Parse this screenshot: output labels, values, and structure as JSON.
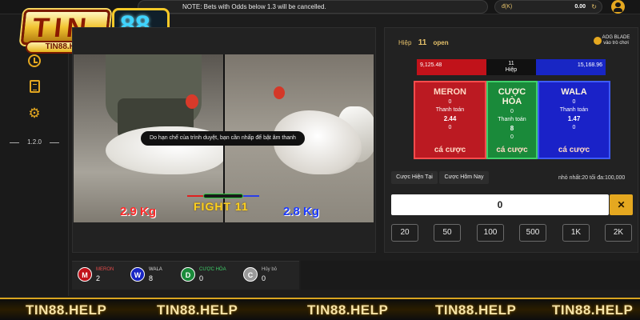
{
  "notice": "NOTE: Bets with Odds below 1.3 will be cancelled.",
  "wallet": {
    "currency": "đ(K)",
    "balance": "0.00",
    "refresh_glyph": "↻"
  },
  "logo": {
    "tin": "TIN",
    "num": "88",
    "help": "TIN88.HELP"
  },
  "sidebar": {
    "version": "1.2.0",
    "icons": [
      "clock-icon",
      "document-icon",
      "gear-icon"
    ]
  },
  "video": {
    "sound_notice": "Do hạn chế của trình duyệt, bạn cần nhấp để bật âm thanh",
    "weight_left": "2.9 Kg",
    "weight_right": "2.8 Kg",
    "fight_label": "FIGHT 11"
  },
  "round": {
    "label": "Hiệp",
    "number": "11",
    "status": "open"
  },
  "brand_tag": {
    "line1": "AOG BLADE",
    "line2": "vào trò chơi"
  },
  "scorebar": {
    "left": "9,125.48",
    "mid_top": "11",
    "mid_bottom": "Hiệp",
    "right": "15,168.96"
  },
  "bet_cards": [
    {
      "name": "MERON",
      "top": "0",
      "payout_label": "Thanh toán",
      "odds": "2.44",
      "bottom": "0",
      "action": "cá cược"
    },
    {
      "name": "CƯỢC HÒA",
      "top": "0",
      "payout_label": "Thanh toán",
      "odds": "8",
      "bottom": "0",
      "action": "cá cược"
    },
    {
      "name": "WALA",
      "top": "0",
      "payout_label": "Thanh toán",
      "odds": "1.47",
      "bottom": "0",
      "action": "cá cược"
    }
  ],
  "tabs": {
    "current": "Cược Hiện Tại",
    "today": "Cược Hôm Nay"
  },
  "limits": "nhỏ nhất:20  tối đa:100,000",
  "amount": {
    "value": "0",
    "clear_glyph": "✕"
  },
  "chips": [
    "20",
    "50",
    "100",
    "500",
    "1K",
    "2K"
  ],
  "results": [
    {
      "letter": "M",
      "label": "MERON",
      "count": "2",
      "color": "#c1121a",
      "label_color": "#e04a4a"
    },
    {
      "letter": "W",
      "label": "WALA",
      "count": "8",
      "color": "#1826c4",
      "label_color": "#dcdcdc"
    },
    {
      "letter": "D",
      "label": "CƯỢC HÒA",
      "count": "0",
      "color": "#1a8a3a",
      "label_color": "#3fd06a"
    },
    {
      "letter": "C",
      "label": "Hủy bỏ",
      "count": "0",
      "color": "#9a9a9a",
      "label_color": "#bbbbbb"
    }
  ],
  "watermark": [
    "TIN88.HELP",
    "TIN88.HELP",
    "TIN88.HELP",
    "TIN88.HELP",
    "TIN88.HELP"
  ]
}
